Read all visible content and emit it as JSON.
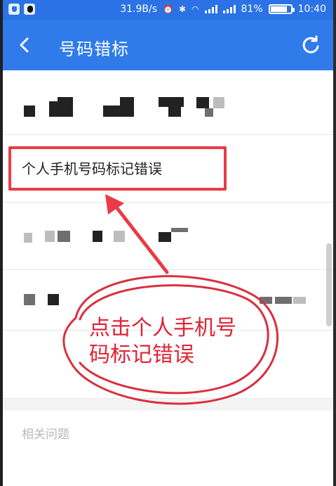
{
  "status_bar": {
    "net_speed": "31.9B/s",
    "battery_percent": "81%",
    "time": "10:40"
  },
  "app_bar": {
    "title": "号码错标",
    "back_icon": "chevron-left-icon",
    "refresh_icon": "refresh-icon"
  },
  "options": [
    {
      "label": "个人手机号码标记错误"
    }
  ],
  "callout": {
    "line1": "点击个人手机号",
    "line2": "码标记错误"
  },
  "footer": {
    "related_label": "相关问题"
  },
  "colors": {
    "primary": "#2f7bea",
    "status": "#2a72e6",
    "annotation_red": "#e02334"
  }
}
